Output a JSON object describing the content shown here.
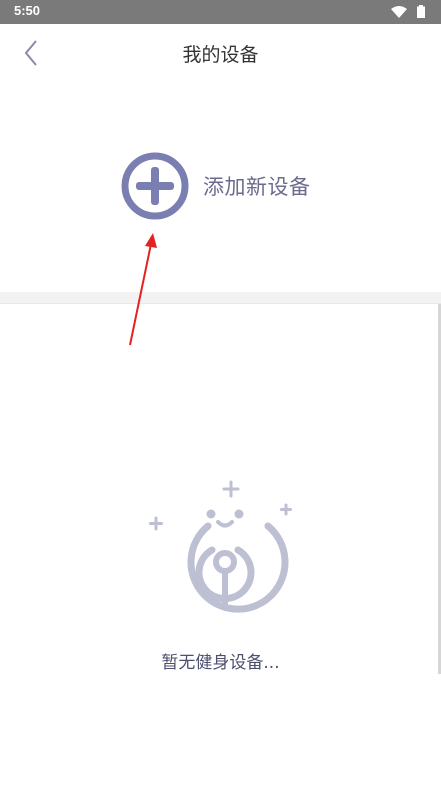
{
  "status_bar": {
    "time": "5:50"
  },
  "nav": {
    "title": "我的设备"
  },
  "add_device": {
    "label": "添加新设备"
  },
  "empty_state": {
    "message": "暂无健身设备..."
  },
  "colors": {
    "accent": "#7b7eb0",
    "illustration": "#bdbfd2",
    "annotation_arrow": "#e52222"
  }
}
